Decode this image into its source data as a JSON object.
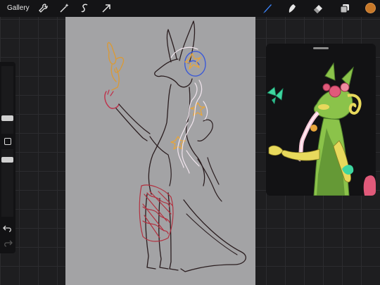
{
  "topbar": {
    "gallery_label": "Gallery",
    "left_tools": [
      "wrench-icon",
      "magic-wand-icon",
      "selection-icon",
      "transform-arrow-icon"
    ],
    "right_tools": [
      "brush-icon",
      "smudge-icon",
      "eraser-icon",
      "layers-icon"
    ],
    "active_tool": "brush-icon",
    "active_tool_color": "#3b82f6",
    "current_color": "#c77828"
  },
  "sidebar": {
    "controls": [
      "brush-size-slider",
      "modify-button",
      "brush-opacity-slider",
      "undo-icon",
      "redo-icon"
    ]
  },
  "canvas": {
    "background_color": "#a3a3a5",
    "description_colors": {
      "lineart": "#2a1d1f",
      "blue_accent": "#3c5ad6",
      "orange_accent": "#e8a53a",
      "red_accent": "#b23040",
      "white_accent": "#f3e6ef"
    }
  },
  "reference": {
    "colors": {
      "body": "#8bc34a",
      "dark_green": "#4d7d2a",
      "yellow": "#e8d95c",
      "pink": "#e05a7a",
      "mint": "#3ed6a0"
    }
  }
}
